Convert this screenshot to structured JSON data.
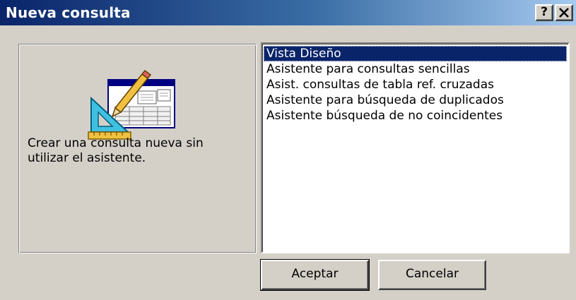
{
  "window": {
    "title": "Nueva consulta",
    "help_label": "?",
    "close_label": "✕"
  },
  "description": {
    "text": "Crear una consulta nueva sin utilizar el asistente."
  },
  "list": {
    "selected_index": 0,
    "items": [
      "Vista Diseño",
      "Asistente para consultas sencillas",
      "Asist. consultas de tabla ref. cruzadas",
      "Asistente para búsqueda de duplicados",
      "Asistente búsqueda de no coincidentes"
    ]
  },
  "buttons": {
    "ok_label": "Aceptar",
    "cancel_label": "Cancelar"
  },
  "colors": {
    "title_gradient_start": "#0a246a",
    "title_gradient_end": "#a6caf0",
    "face": "#d4d0c8",
    "selection": "#0a246a"
  },
  "icons": {
    "wizard_art": "design-view-illustration-icon"
  }
}
